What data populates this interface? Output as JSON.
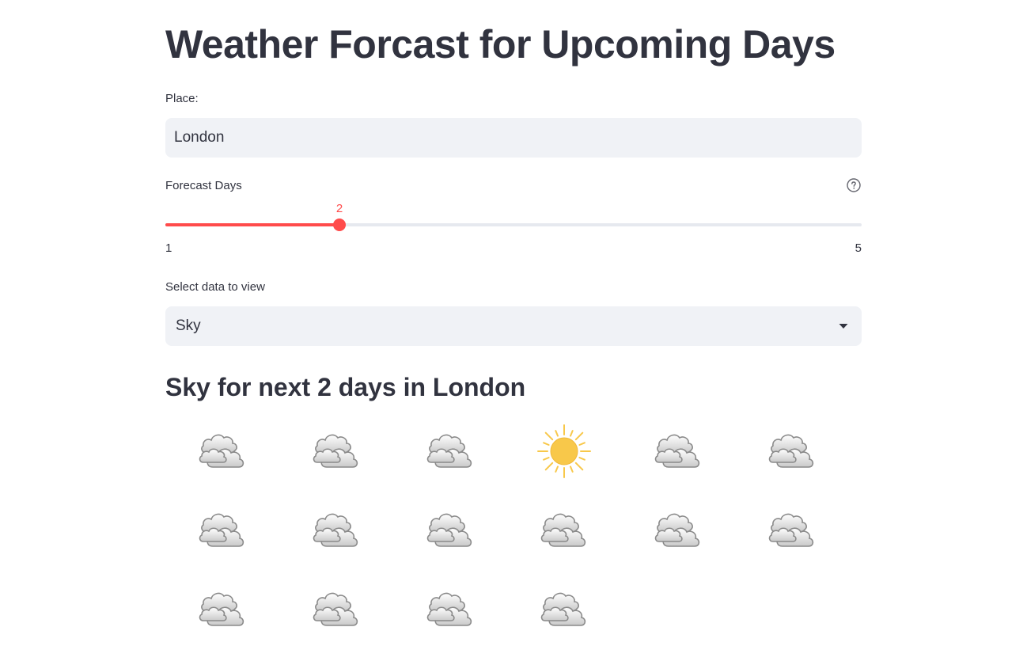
{
  "page": {
    "title": "Weather Forcast for Upcoming Days"
  },
  "place": {
    "label": "Place:",
    "value": "London"
  },
  "forecast_days": {
    "label": "Forecast Days",
    "value": 2,
    "value_text": "2",
    "min": 1,
    "max": 5,
    "min_text": "1",
    "max_text": "5"
  },
  "data_select": {
    "label": "Select data to view",
    "selected": "Sky"
  },
  "results": {
    "heading": "Sky for next 2 days in London",
    "icons": [
      "cloud-icon",
      "cloud-icon",
      "cloud-icon",
      "sun-icon",
      "cloud-icon",
      "cloud-icon",
      "cloud-icon",
      "cloud-icon",
      "cloud-icon",
      "cloud-icon",
      "cloud-icon",
      "cloud-icon",
      "cloud-icon",
      "cloud-icon",
      "cloud-icon",
      "cloud-icon"
    ]
  },
  "colors": {
    "accent": "#ff4b4b",
    "text": "#31333f",
    "input_bg": "#f0f2f6",
    "track": "#e6e9ef",
    "sun": "#f8c84a"
  }
}
